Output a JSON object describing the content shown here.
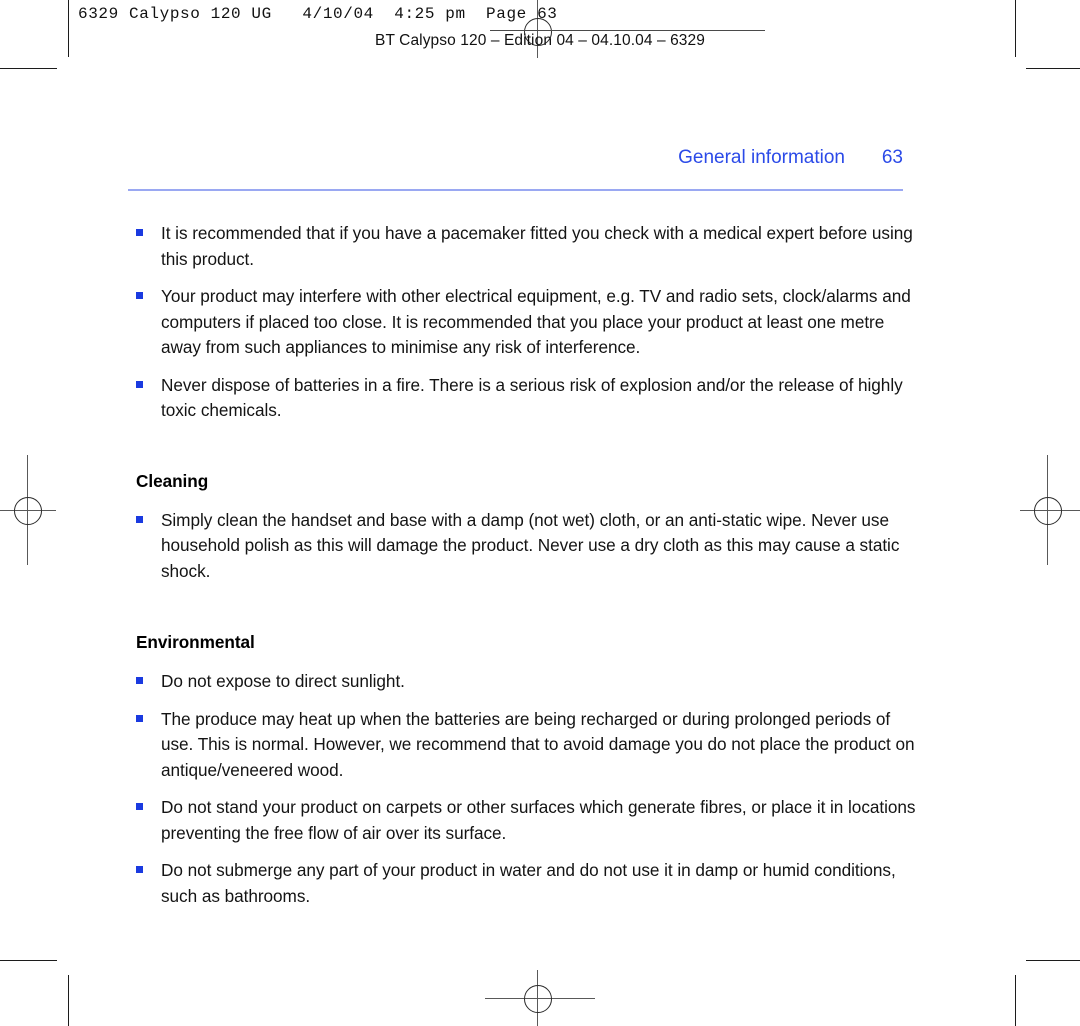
{
  "slug": {
    "text": "6329 Calypso 120 UG   4/10/04  4:25 pm  Page 63"
  },
  "edition": {
    "text": "BT Calypso 120 – Edition 04 – 04.10.04 – 6329"
  },
  "header": {
    "title": "General information",
    "page_number": "63",
    "rule_color": "#9aa8f2",
    "accent_color": "#2b4ae8"
  },
  "bullet_color": "#1a3ae0",
  "body": {
    "blocks": [
      {
        "kind": "bullet",
        "text": "It is recommended that if you have a pacemaker fitted you check with a medical expert before using this product."
      },
      {
        "kind": "bullet",
        "text": "Your product may interfere with other electrical equipment, e.g. TV and radio sets, clock/alarms and computers if placed too close. It is recommended that you place your product at least one metre away from such appliances to minimise any risk of interference."
      },
      {
        "kind": "bullet",
        "text": "Never dispose of batteries in a fire. There is a serious risk of explosion and/or the release of highly toxic chemicals."
      },
      {
        "kind": "heading",
        "text": "Cleaning"
      },
      {
        "kind": "bullet",
        "text": "Simply clean the handset and base with a damp (not wet) cloth, or an anti-static wipe. Never use household polish as this will damage the product. Never use a dry cloth as this may cause a static shock."
      },
      {
        "kind": "heading",
        "text": "Environmental"
      },
      {
        "kind": "bullet",
        "text": "Do not expose to direct sunlight."
      },
      {
        "kind": "bullet",
        "text": "The produce may heat up when the batteries are being recharged or during prolonged periods of use. This is normal. However, we recommend that to avoid damage you do not place the product on antique/veneered wood."
      },
      {
        "kind": "bullet",
        "text": "Do not stand your product on carpets or other surfaces which generate fibres, or place it in locations preventing the free flow of air over its surface."
      },
      {
        "kind": "bullet",
        "text": "Do not submerge any part of your product in water and do not use it in damp or humid conditions, such as bathrooms."
      }
    ]
  }
}
